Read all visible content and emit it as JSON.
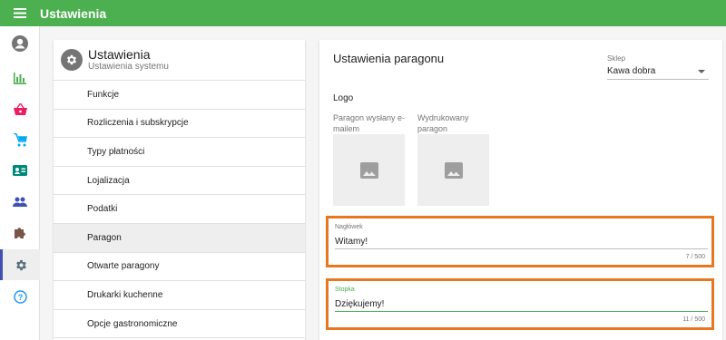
{
  "header": {
    "title": "Ustawienia"
  },
  "colors": {
    "primary": "#4caf50",
    "accent_border": "#e87722",
    "active_rail": "#3f51b5"
  },
  "sidebar": {
    "items": [
      {
        "icon": "account-circle-icon",
        "color": "#757575"
      },
      {
        "icon": "bar-chart-icon",
        "color": "#4caf50"
      },
      {
        "icon": "basket-icon",
        "color": "#e91e63"
      },
      {
        "icon": "cart-icon",
        "color": "#03a9f4"
      },
      {
        "icon": "contact-card-icon",
        "color": "#00897b"
      },
      {
        "icon": "people-icon",
        "color": "#3f51b5"
      },
      {
        "icon": "puzzle-icon",
        "color": "#795548"
      },
      {
        "icon": "gear-icon",
        "color": "#546e7a"
      },
      {
        "icon": "help-icon",
        "color": "#2196f3"
      }
    ]
  },
  "settings_menu": {
    "title": "Ustawienia",
    "subtitle": "Ustawienia systemu",
    "items": [
      {
        "label": "Funkcje"
      },
      {
        "label": "Rozliczenia i subskrypcje"
      },
      {
        "label": "Typy płatności"
      },
      {
        "label": "Lojalizacja"
      },
      {
        "label": "Podatki"
      },
      {
        "label": "Paragon"
      },
      {
        "label": "Otwarte paragony"
      },
      {
        "label": "Drukarki kuchenne"
      },
      {
        "label": "Opcje gastronomiczne"
      }
    ],
    "selected_index": 5
  },
  "receipt": {
    "title": "Ustawienia paragonu",
    "shop_label": "Sklep",
    "shop_value": "Kawa dobra",
    "logo_label": "Logo",
    "logo_emailed_caption": "Paragon wysłany e-mailem",
    "logo_printed_caption": "Wydrukowany paragon",
    "header_label": "Nagłówek",
    "header_value": "Witamy!",
    "header_count": "7 / 500",
    "footer_label": "Stopka",
    "footer_value": "Dziękujemy!",
    "footer_count": "11 / 500"
  }
}
